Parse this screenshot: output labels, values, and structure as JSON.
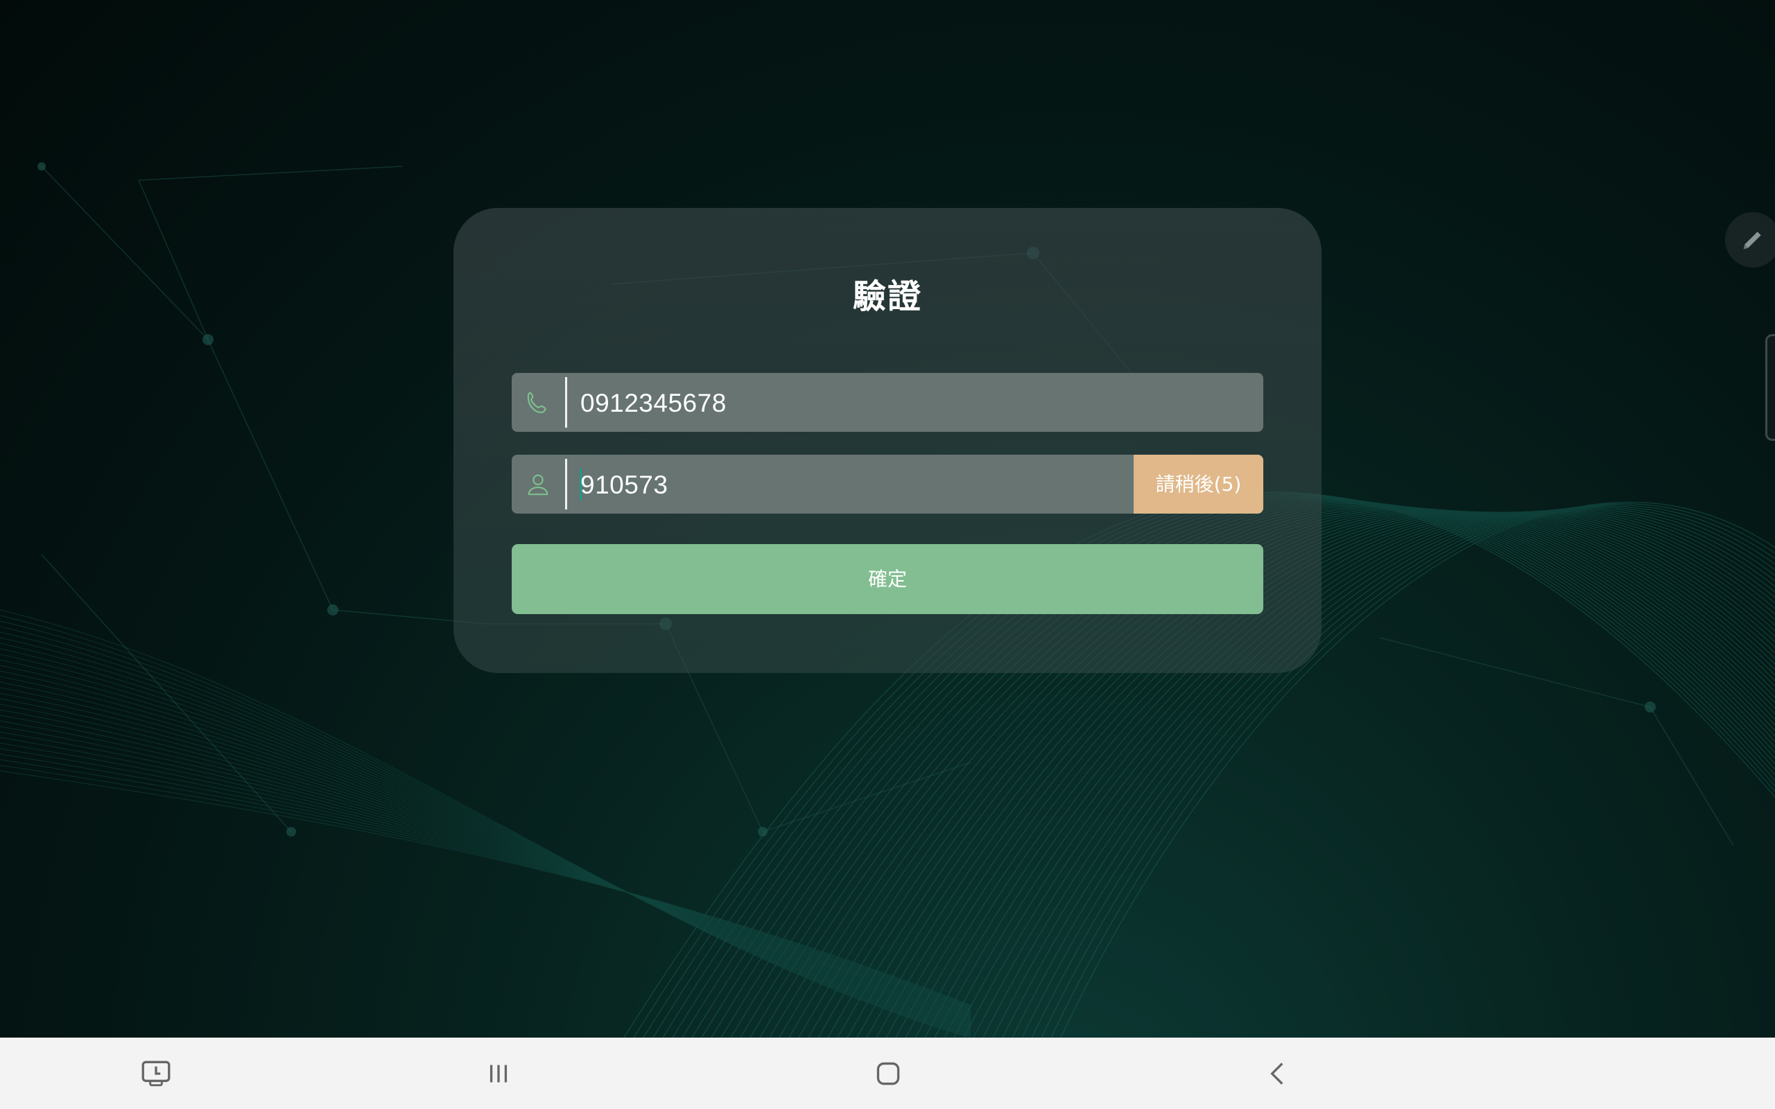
{
  "dialog": {
    "title": "驗證",
    "phone_value": "0912345678",
    "phone_icon": "phone-icon",
    "code_value": "910573",
    "code_icon": "user-icon",
    "wait_button_label": "請稍後(5)",
    "confirm_button_label": "確定"
  },
  "floating": {
    "edit_icon": "pencil-icon"
  },
  "navbar": {
    "items": [
      "screen-share-icon",
      "recent-apps-icon",
      "home-icon",
      "back-icon"
    ]
  },
  "colors": {
    "field_bg": "#677472",
    "wait_button_bg": "#e0b88a",
    "confirm_button_bg": "#82be91",
    "icon_accent": "#7fc08e",
    "caret": "#1a9d8a"
  }
}
